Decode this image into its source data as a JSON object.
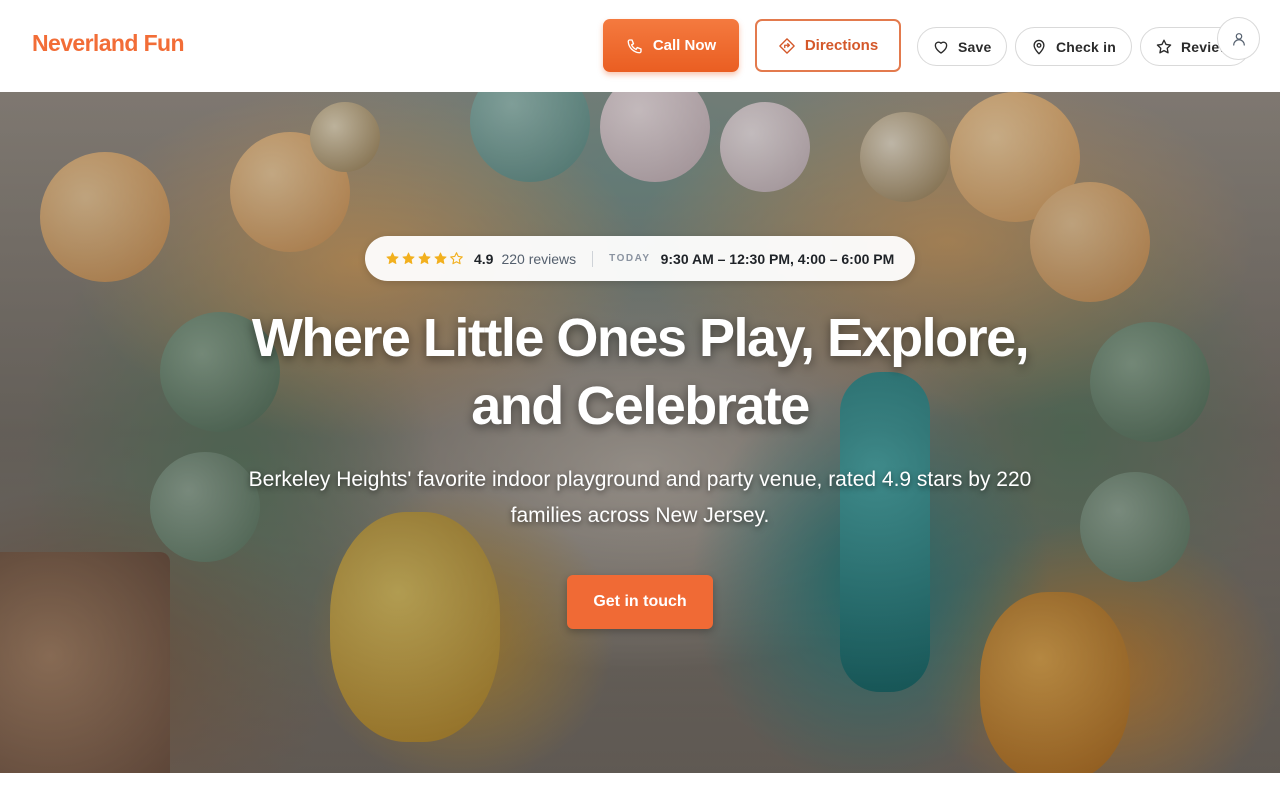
{
  "header": {
    "brand": "Neverland Fun",
    "call_label": "Call Now",
    "directions_label": "Directions",
    "save_label": "Save",
    "checkin_label": "Check in",
    "review_label": "Review",
    "icons": {
      "call": "phone-icon",
      "directions": "directions-icon",
      "save": "heart-icon",
      "checkin": "map-pin-icon",
      "review": "star-icon",
      "avatar": "user-icon"
    }
  },
  "hero": {
    "rating": {
      "stars_filled": 4,
      "stars_total": 5,
      "value": "4.9",
      "reviews": "220 reviews"
    },
    "today_label": "TODAY",
    "hours": "9:30 AM – 12:30 PM, 4:00 – 6:00 PM",
    "headline_line1": "Where Little Ones Play, Explore,",
    "headline_line2": "and Celebrate",
    "subtext": "Berkeley Heights' favorite indoor playground and party venue, rated 4.9 stars by 220 families across New Jersey.",
    "cta_label": "Get in touch"
  },
  "colors": {
    "brand": "#f26d37",
    "primary_button": "#ea5e22",
    "outline_button": "#e37a4d",
    "star": "#f2b01e"
  }
}
